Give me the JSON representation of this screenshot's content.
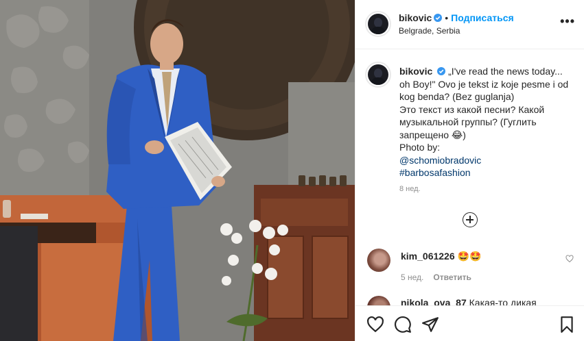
{
  "post": {
    "username": "bikovic",
    "follow_label": "Подписаться",
    "separator": "•",
    "location": "Belgrade, Serbia",
    "more_label": "•••",
    "caption": {
      "line1": "„I've read the news today... oh Boy!\" Ovo je tekst iz koje pesme i od kog benda? (Bez guglanja)",
      "line2": "Это текст из какой песни? Какой музыкальной группы? (Гуглить запрещено 😂)",
      "line3": "Photo by:",
      "mention": "@schomiobradovic",
      "hashtag": "#barbosafashion"
    },
    "time": "8 нед."
  },
  "comments": [
    {
      "username": "kim_061226",
      "text": "🤩🤩",
      "time": "5 нед.",
      "reply_label": "Ответить"
    },
    {
      "username": "nikola_ova_87",
      "text": "Какая-то дикая"
    }
  ],
  "icons": {
    "verified": "verified-badge-icon",
    "more": "more-options-icon",
    "load_more": "plus-circle-icon",
    "like": "heart-icon",
    "comment": "comment-icon",
    "share": "send-icon",
    "save": "bookmark-icon"
  },
  "colors": {
    "accent": "#0095f6",
    "link": "#00376b",
    "muted": "#8e8e8e",
    "suit": "#2f5fc4"
  }
}
